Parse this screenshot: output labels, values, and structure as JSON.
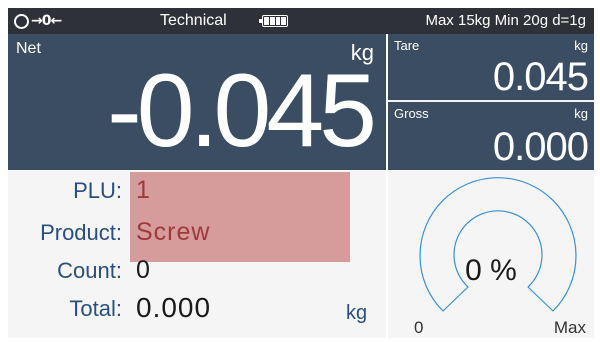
{
  "colors": {
    "status_bar": "#2e3238",
    "display_panel": "#3a4d63",
    "label_blue": "#2a4e80",
    "highlight": "#d69b9b",
    "gauge_arc": "#3b8fd4"
  },
  "status_bar": {
    "zero_icon": "zero-indicator-icon",
    "zero_arrows": "→0←",
    "mode": "Technical",
    "battery_icon": "battery-icon",
    "range": "Max 15kg Min 20g d=1g"
  },
  "net": {
    "label": "Net",
    "unit": "kg",
    "value": "-0.045"
  },
  "tare": {
    "label": "Tare",
    "unit": "kg",
    "value": "0.045"
  },
  "gross": {
    "label": "Gross",
    "unit": "kg",
    "value": "0.000"
  },
  "info": {
    "plu_label": "PLU:",
    "plu_value": "1",
    "product_label": "Product:",
    "product_value": "Screw",
    "count_label": "Count:",
    "count_value": "0",
    "total_label": "Total:",
    "total_value": "0.000",
    "total_unit": "kg"
  },
  "gauge": {
    "percent_text": "0 %",
    "fill_fraction": 0,
    "min_label": "0",
    "max_label": "Max"
  }
}
